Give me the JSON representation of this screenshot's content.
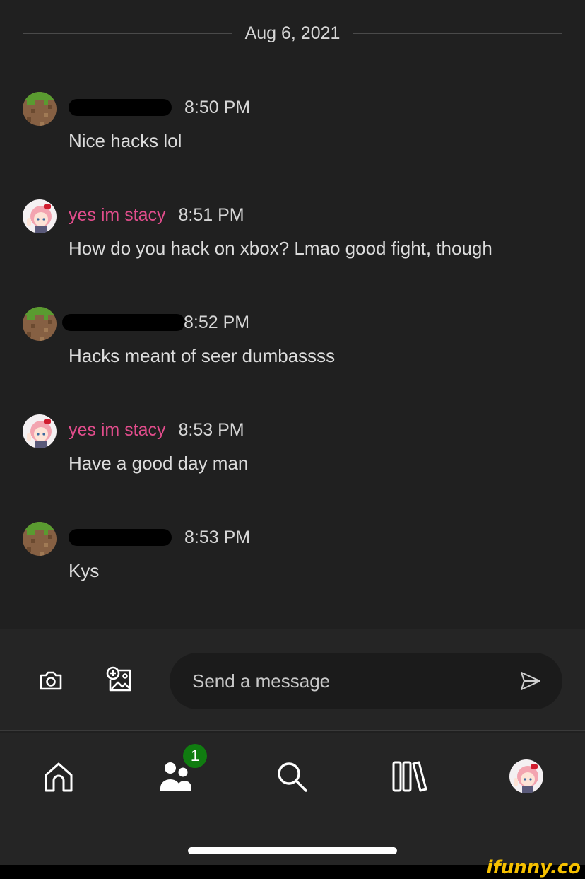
{
  "date_separator": "Aug 6, 2021",
  "messages": [
    {
      "author": "",
      "author_redacted": true,
      "time": "8:50 PM",
      "text": "Nice hacks lol"
    },
    {
      "author": "yes im stacy",
      "author_redacted": false,
      "time": "8:51 PM",
      "text": "How do you hack on xbox? Lmao good fight, though"
    },
    {
      "author": "",
      "author_redacted": true,
      "time": "8:52 PM",
      "text": "Hacks meant of seer dumbassss"
    },
    {
      "author": "yes im stacy",
      "author_redacted": false,
      "time": "8:53 PM",
      "text": "Have a good day man"
    },
    {
      "author": "",
      "author_redacted": true,
      "time": "8:53 PM",
      "text": "Kys"
    }
  ],
  "composer": {
    "placeholder": "Send a message",
    "icons": [
      "camera-icon",
      "add-image-icon",
      "send-icon"
    ]
  },
  "nav": {
    "items": [
      "home-icon",
      "friends-icon",
      "search-icon",
      "library-icon",
      "profile-avatar"
    ],
    "friends_badge": "1"
  },
  "watermark": "ifunny.co",
  "colors": {
    "background": "#202020",
    "username_pink": "#e24d8c",
    "badge_green": "#107c10",
    "watermark_yellow": "#f5c000"
  }
}
